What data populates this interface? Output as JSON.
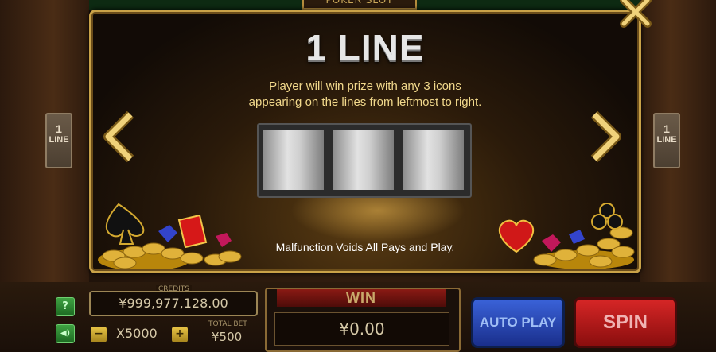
{
  "header": {
    "game_title": "POKER SLOT"
  },
  "panel": {
    "title": "1 LINE",
    "description_line1": "Player will win prize with any 3 icons",
    "description_line2": "appearing on the lines from leftmost to right.",
    "disclaimer": "Malfunction Voids All Pays and Play.",
    "reels": [
      "",
      "",
      ""
    ]
  },
  "side_tabs": {
    "left": {
      "number": "1",
      "label": "LINE"
    },
    "right": {
      "number": "1",
      "label": "LINE"
    }
  },
  "icons": {
    "prev": "chevron-left-icon",
    "next": "chevron-right-icon",
    "close": "close-icon"
  },
  "bottom": {
    "help_label": "?",
    "sound_label": "◀)",
    "credits_label": "CREDITS",
    "credits_value": "¥999,977,128.00",
    "bet_minus": "−",
    "bet_multiplier": "X5000",
    "bet_plus": "+",
    "total_bet_label": "TOTAL BET",
    "total_bet_value": "¥500",
    "win_label": "WIN",
    "win_value": "¥0.00",
    "auto_play_label": "AUTO PLAY",
    "spin_label": "SPIN"
  },
  "colors": {
    "gold_border": "#c9a248",
    "desc_text": "#f2d98c",
    "auto_play_blue": "#2a4ab8",
    "spin_red": "#c01818"
  }
}
